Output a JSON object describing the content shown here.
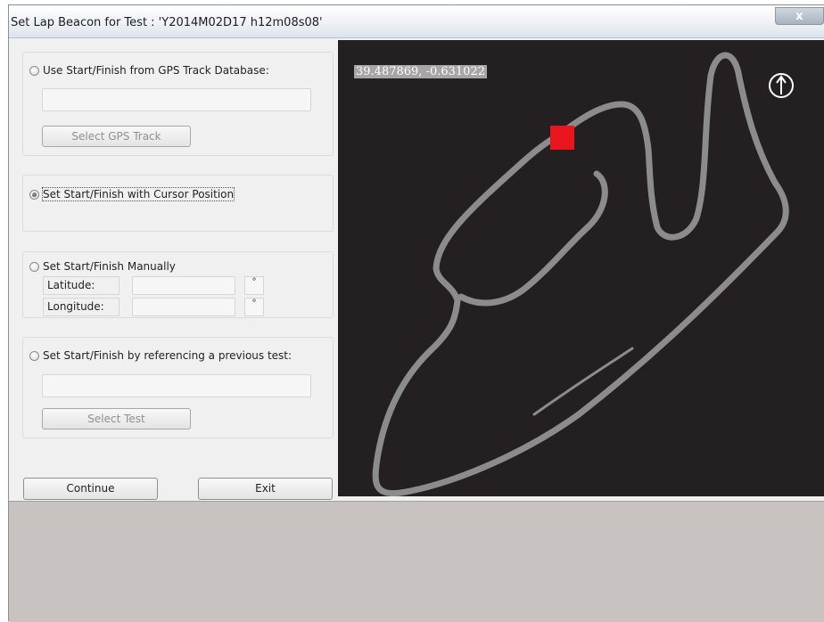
{
  "window": {
    "title": "Set Lap Beacon for Test : 'Y2014M02D17 h12m08s08'",
    "close_glyph": "x"
  },
  "options": {
    "gps_db": {
      "label": "Use Start/Finish from GPS Track Database:",
      "selected": false,
      "field_value": "",
      "button_label": "Select GPS Track"
    },
    "cursor": {
      "label": "Set Start/Finish with Cursor Position",
      "selected": true
    },
    "manual": {
      "label": "Set Start/Finish Manually",
      "selected": false,
      "latitude_label": "Latitude:",
      "longitude_label": "Longitude:",
      "latitude_value": "",
      "longitude_value": "",
      "degree_symbol": "°"
    },
    "previous": {
      "label": "Set Start/Finish by referencing a previous test:",
      "selected": false,
      "field_value": "",
      "button_label": "Select Test"
    }
  },
  "buttons": {
    "continue_label": "Continue",
    "exit_label": "Exit"
  },
  "map": {
    "coordinates": "39.487869, -0.631022",
    "compass_icon": "north-arrow-icon",
    "background_color": "#241f20",
    "track_color": "#8c8c8c",
    "marker_color": "#e8141e"
  }
}
